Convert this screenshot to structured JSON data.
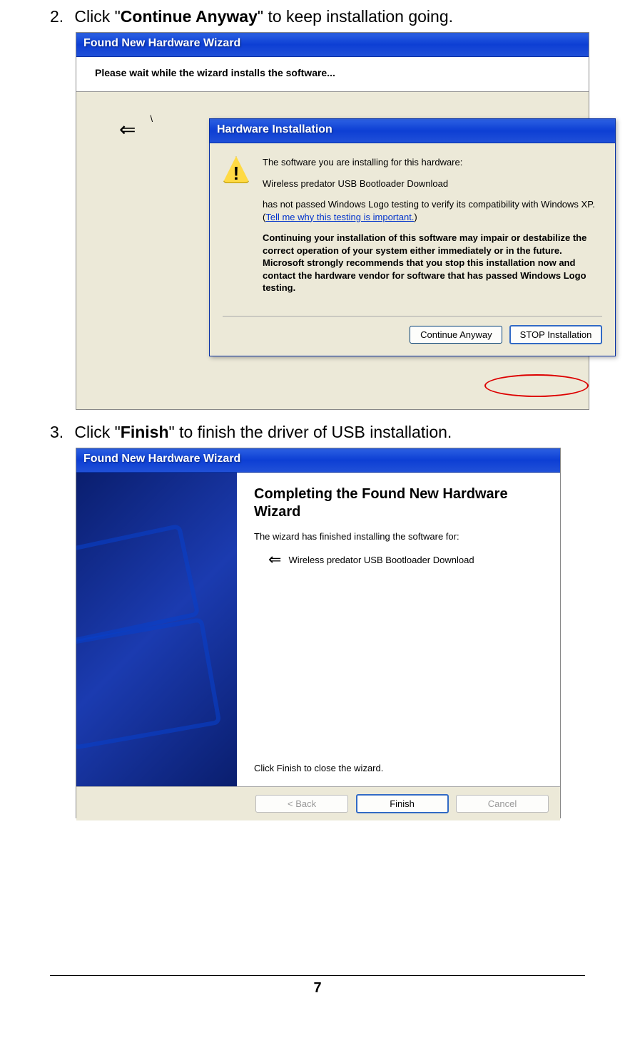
{
  "step2": {
    "num": "2.",
    "pre": "Click \"",
    "bold": "Continue Anyway",
    "post": "\" to keep installation going."
  },
  "step3": {
    "num": "3.",
    "pre": "Click \"",
    "bold": "Finish",
    "post": "\" to finish the driver of USB installation."
  },
  "wizard1": {
    "title": "Found New Hardware Wizard",
    "header": "Please wait while the wizard installs the software..."
  },
  "hwdlg": {
    "title": "Hardware Installation",
    "line1": "The software you are installing for this hardware:",
    "device": "Wireless predator USB Bootloader Download",
    "line2a": "has not passed Windows Logo testing to verify its compatibility with Windows XP. (",
    "link": "Tell me why this testing is important.",
    "line2b": ")",
    "warn": "Continuing your installation of this software may impair or destabilize the correct operation of your system either immediately or in the future. Microsoft strongly recommends that you stop this installation now and contact the hardware vendor for software that has passed Windows Logo testing.",
    "btn_continue": "Continue Anyway",
    "btn_stop": "STOP Installation"
  },
  "wizard2": {
    "title": "Found New Hardware Wizard",
    "heading": "Completing the Found New Hardware Wizard",
    "line1": "The wizard has finished installing the software for:",
    "device": "Wireless predator USB Bootloader Download",
    "close": "Click Finish to close the wizard.",
    "btn_back": "< Back",
    "btn_finish": "Finish",
    "btn_cancel": "Cancel"
  },
  "page_number": "7"
}
